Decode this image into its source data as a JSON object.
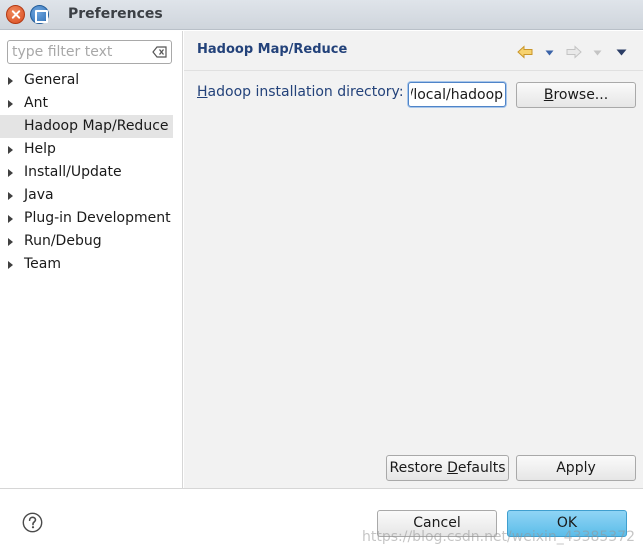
{
  "window": {
    "title": "Preferences"
  },
  "filter": {
    "placeholder": "type filter text",
    "value": ""
  },
  "tree": {
    "items": [
      {
        "label": "General",
        "expandable": true,
        "selected": false
      },
      {
        "label": "Ant",
        "expandable": true,
        "selected": false
      },
      {
        "label": "Hadoop Map/Reduce",
        "expandable": false,
        "selected": true
      },
      {
        "label": "Help",
        "expandable": true,
        "selected": false
      },
      {
        "label": "Install/Update",
        "expandable": true,
        "selected": false
      },
      {
        "label": "Java",
        "expandable": true,
        "selected": false
      },
      {
        "label": "Plug-in Development",
        "expandable": true,
        "selected": false
      },
      {
        "label": "Run/Debug",
        "expandable": true,
        "selected": false
      },
      {
        "label": "Team",
        "expandable": true,
        "selected": false
      }
    ]
  },
  "page": {
    "title": "Hadoop Map/Reduce",
    "field_label_mnemonic": "H",
    "field_label_rest": "adoop installation directory:",
    "directory_value": "/usr/local/hadoop",
    "browse_pre": "",
    "browse_mnemonic": "B",
    "browse_rest": "rowse...",
    "restore_pre": "Restore ",
    "restore_mnemonic": "D",
    "restore_rest": "efaults",
    "apply_label": "Apply"
  },
  "footer": {
    "cancel_label": "Cancel",
    "ok_label": "OK",
    "watermark": "https://blog.csdn.net/weixin_43385372"
  },
  "colors": {
    "accent": "#23427a",
    "ok_button": "#5cbde9",
    "selection": "#e4e4e4"
  },
  "icons": {
    "close": "close-icon",
    "maximize": "maximize-icon",
    "clear": "clear-filter-icon",
    "back": "back-arrow-icon",
    "forward": "forward-arrow-icon",
    "menu": "chevron-down-icon",
    "help": "help-icon"
  }
}
